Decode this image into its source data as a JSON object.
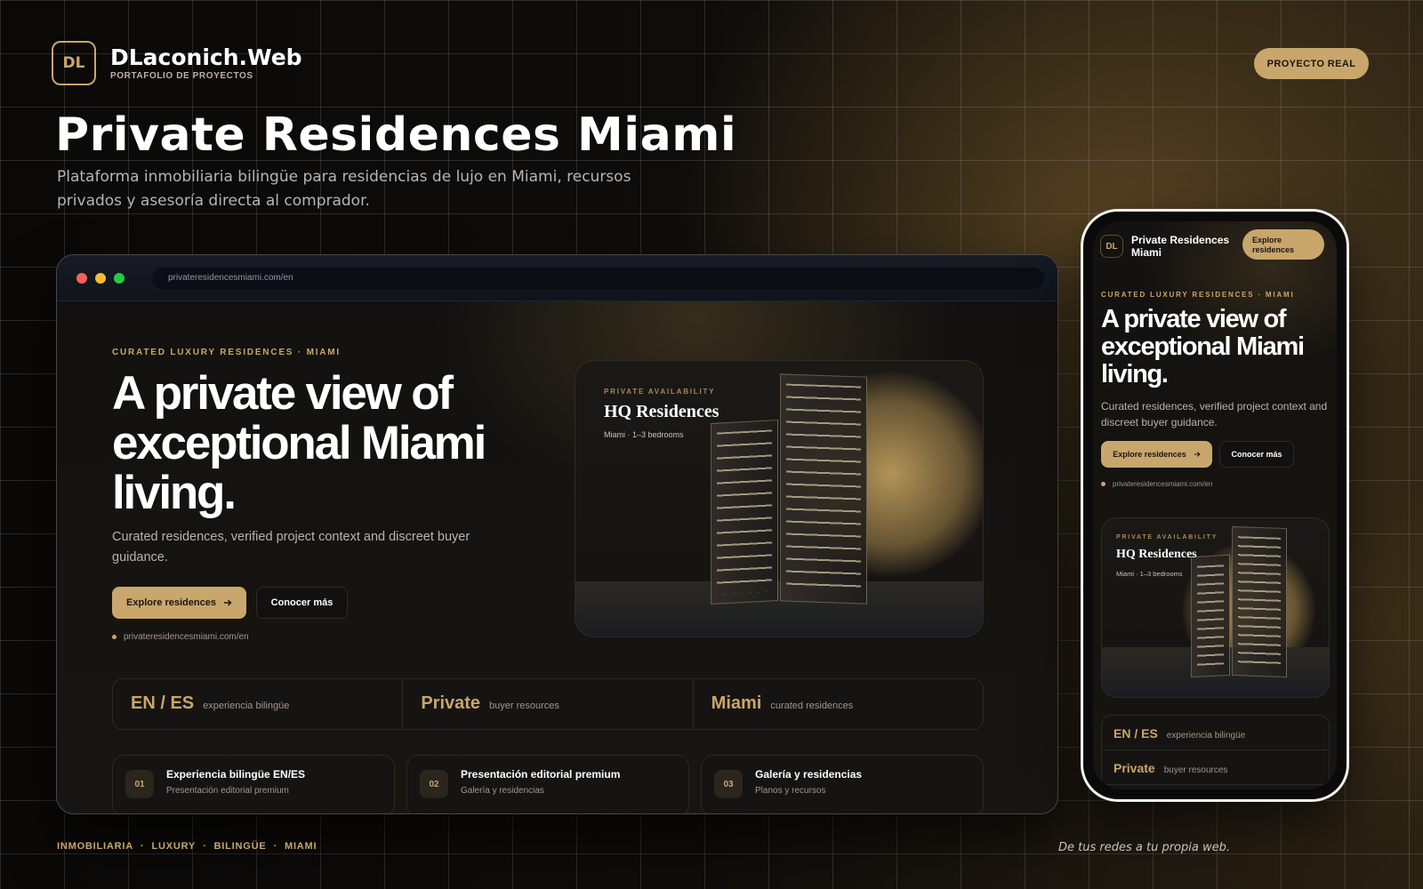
{
  "brand": {
    "logo": "DL",
    "name": "DLaconich.Web",
    "subtitle": "PORTAFOLIO DE PROYECTOS"
  },
  "badge": "PROYECTO REAL",
  "project": {
    "title": "Private Residences Miami",
    "description": "Plataforma inmobiliaria bilingüe para residencias de lujo en Miami, recursos privados y asesoría directa al comprador."
  },
  "browser": {
    "url": "privateresidencesmiami.com/en",
    "kicker": "CURATED LUXURY RESIDENCES · MIAMI",
    "heading": "A private view of exceptional Miami living.",
    "paragraph": "Curated residences, verified project context and discreet buyer guidance.",
    "primary_button": "Explore residences",
    "secondary_button": "Conocer más",
    "url_note": "privateresidencesmiami.com/en",
    "card": {
      "kicker": "PRIVATE AVAILABILITY",
      "title": "HQ Residences",
      "subtitle": "Miami · 1–3 bedrooms"
    },
    "stats": [
      {
        "big": "EN / ES",
        "small": "experiencia bilingüe"
      },
      {
        "big": "Private",
        "small": "buyer resources"
      },
      {
        "big": "Miami",
        "small": "curated residences"
      }
    ],
    "features": [
      {
        "num": "01",
        "title": "Experiencia bilingüe EN/ES",
        "sub": "Presentación editorial premium"
      },
      {
        "num": "02",
        "title": "Presentación editorial premium",
        "sub": "Galería y residencias"
      },
      {
        "num": "03",
        "title": "Galería y residencias",
        "sub": "Planos y recursos"
      }
    ]
  },
  "phone": {
    "logo": "DL",
    "brand": "Private Residences Miami",
    "header_button": "Explore residences",
    "kicker": "CURATED LUXURY RESIDENCES · MIAMI",
    "heading": "A private view of exceptional Miami living.",
    "paragraph": "Curated residences, verified project context and discreet buyer guidance.",
    "primary_button": "Explore residences",
    "secondary_button": "Conocer más",
    "url_note": "privateresidencesmiami.com/en",
    "card": {
      "kicker": "PRIVATE AVAILABILITY",
      "title": "HQ Residences",
      "subtitle": "Miami · 1–3 bedrooms"
    },
    "stats": [
      {
        "big": "EN / ES",
        "small": "experiencia bilingüe"
      },
      {
        "big": "Private",
        "small": "buyer resources"
      }
    ]
  },
  "footer": {
    "tags": [
      "INMOBILIARIA",
      "LUXURY",
      "BILINGÜE",
      "MIAMI"
    ],
    "separator": "·",
    "quote": "De tus redes a tu propia web."
  },
  "colors": {
    "accent": "#c9a66b",
    "background": "#0c0b0a",
    "text": "#ffffff"
  },
  "icons": {
    "button_arrow": "arrow-right-icon"
  }
}
